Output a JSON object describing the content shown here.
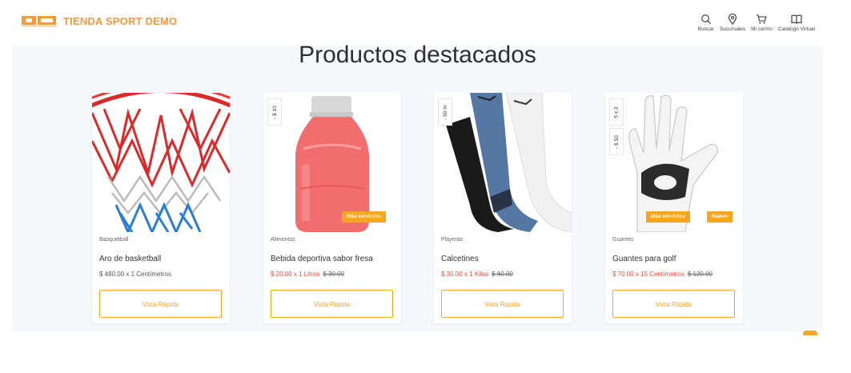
{
  "brand": {
    "name": "TIENDA SPORT DEMO"
  },
  "nav": [
    {
      "icon": "search-icon",
      "label": "Buscar"
    },
    {
      "icon": "location-pin-icon",
      "label": "Sucursales"
    },
    {
      "icon": "cart-icon",
      "label": "Mi carrito"
    },
    {
      "icon": "book-icon",
      "label": "Catálogo Virtual"
    }
  ],
  "section": {
    "title": "Productos destacados"
  },
  "products": [
    {
      "category": "Basquetball",
      "name": "Aro de basketball",
      "price": "$ 480.00 x 1 Centímetros",
      "old_price": "",
      "badges": [],
      "tags": [],
      "button": "Vista Rápida"
    },
    {
      "category": "Alimentos",
      "name": "Bebida deportiva sabor fresa",
      "price": "$ 20.00 x 1 Litros",
      "old_price": "$ 30.00",
      "badges": [
        "- $ 10"
      ],
      "tags": [
        "Más vendidos"
      ],
      "button": "Vista Rápida"
    },
    {
      "category": "Playeras",
      "name": "Calcetines",
      "price": "$ 30.00 x 1 Kilos",
      "old_price": "$ 80.00",
      "badges": [
        "- 50 %"
      ],
      "tags": [],
      "button": "Vista Rápida"
    },
    {
      "category": "Guantes",
      "name": "Guantes para golf",
      "price": "$ 70.00 x 15 Centímetros",
      "old_price": "$ 120.00",
      "badges": [
        "5 x 3",
        "- $ 50"
      ],
      "tags": [
        "Más vendidos",
        "Nuevo"
      ],
      "button": "Vista Rápida"
    }
  ],
  "colors": {
    "accent": "#f5a623",
    "brand": "#f39a3a",
    "sale_price": "#e24b3b",
    "panel_bg": "#f5f8fc"
  }
}
